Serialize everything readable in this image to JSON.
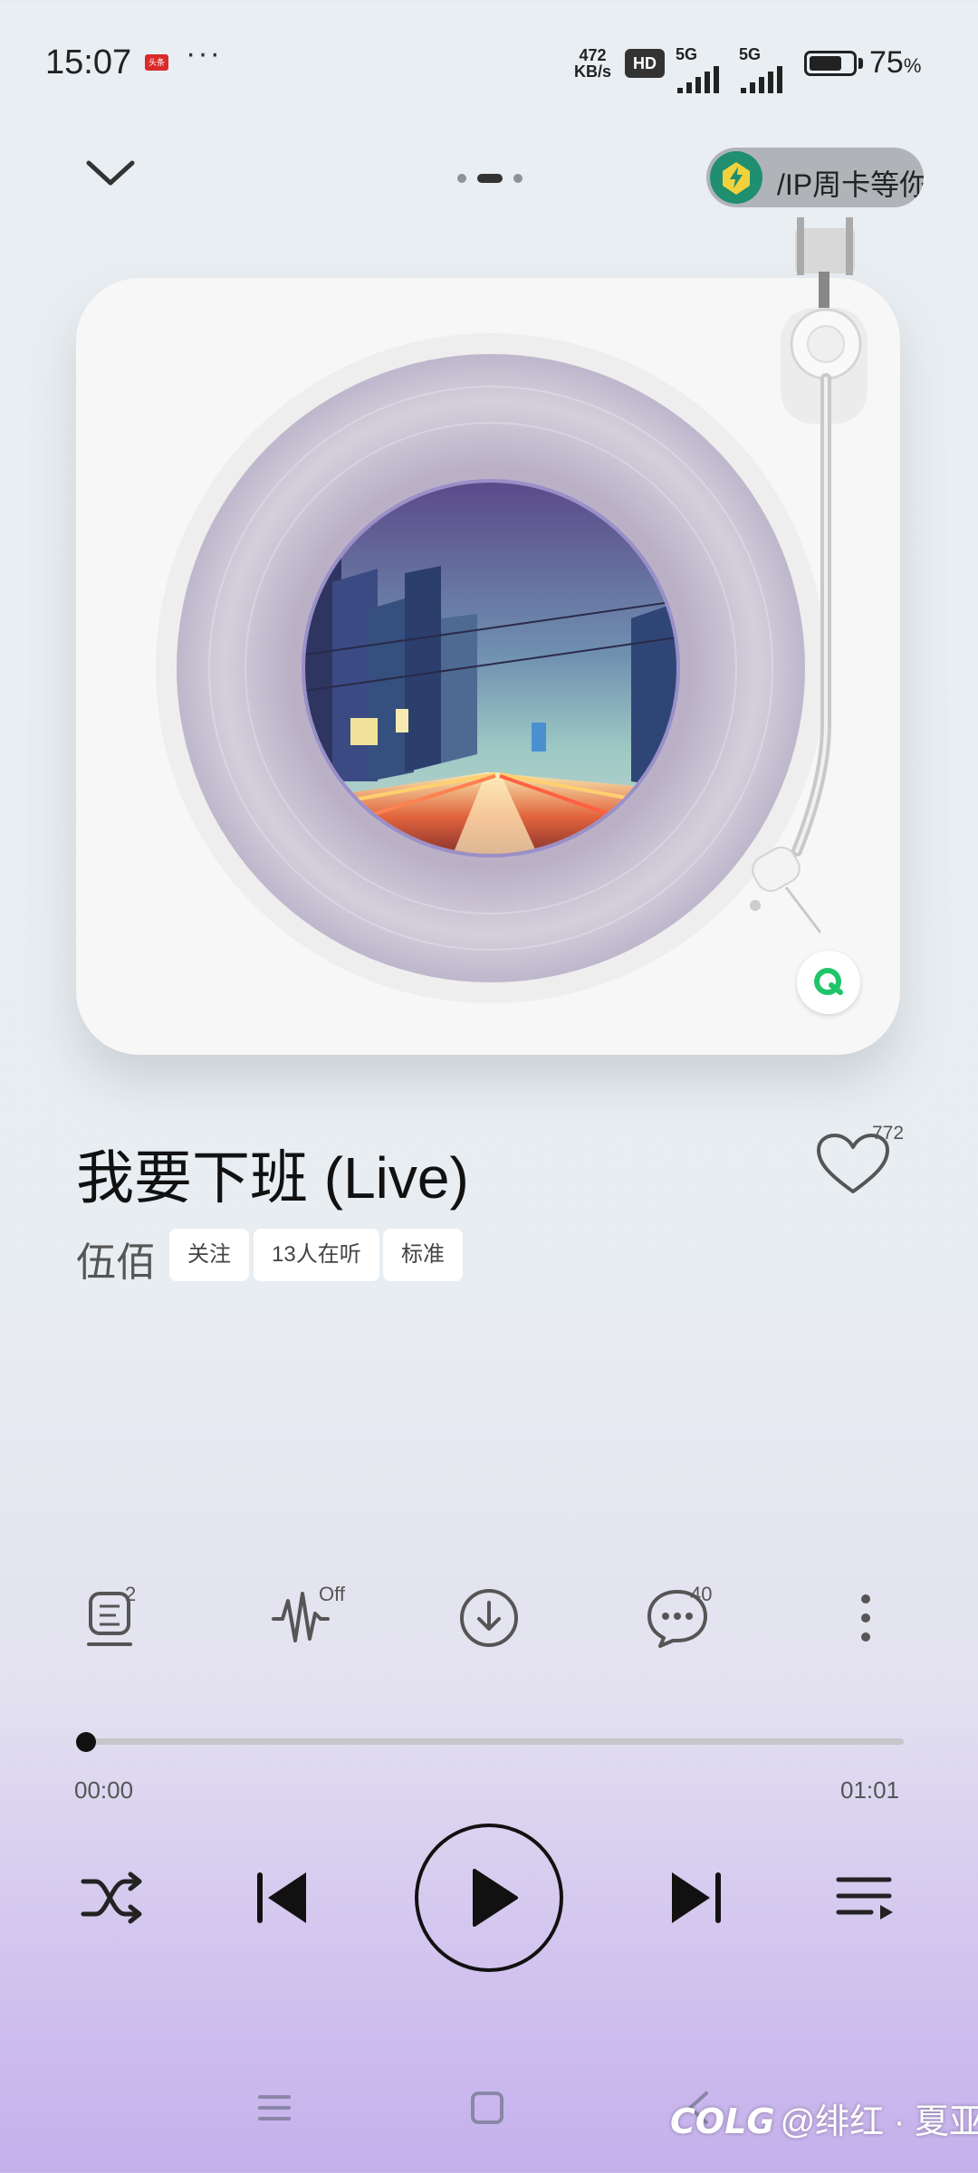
{
  "status_bar": {
    "time": "15:07",
    "app_badge": "头条",
    "more": "···",
    "net_speed_value": "472",
    "net_speed_unit": "KB/s",
    "hd": "HD",
    "sim1": "5G",
    "sim2": "5G",
    "battery_level": 0.75,
    "battery_percent": "75",
    "battery_unit": "%"
  },
  "header": {
    "vip_text": "/IP周卡等你"
  },
  "song": {
    "title": "我要下班 (Live)",
    "artist": "伍佰",
    "like_count": "772",
    "tags": [
      "关注",
      "13人在听",
      "标准"
    ]
  },
  "actions": {
    "lyrics_badge": "2",
    "effect_badge": "Off",
    "comment_badge": "40"
  },
  "progress": {
    "current": "00:00",
    "total": "01:01",
    "fraction": 0.0
  },
  "watermark": {
    "logo": "COLG",
    "text": "@绯红 · 夏亚"
  },
  "colors": {
    "accent": "#111111",
    "vip_green": "#1f8f6f",
    "logo_green": "#20c56a"
  }
}
